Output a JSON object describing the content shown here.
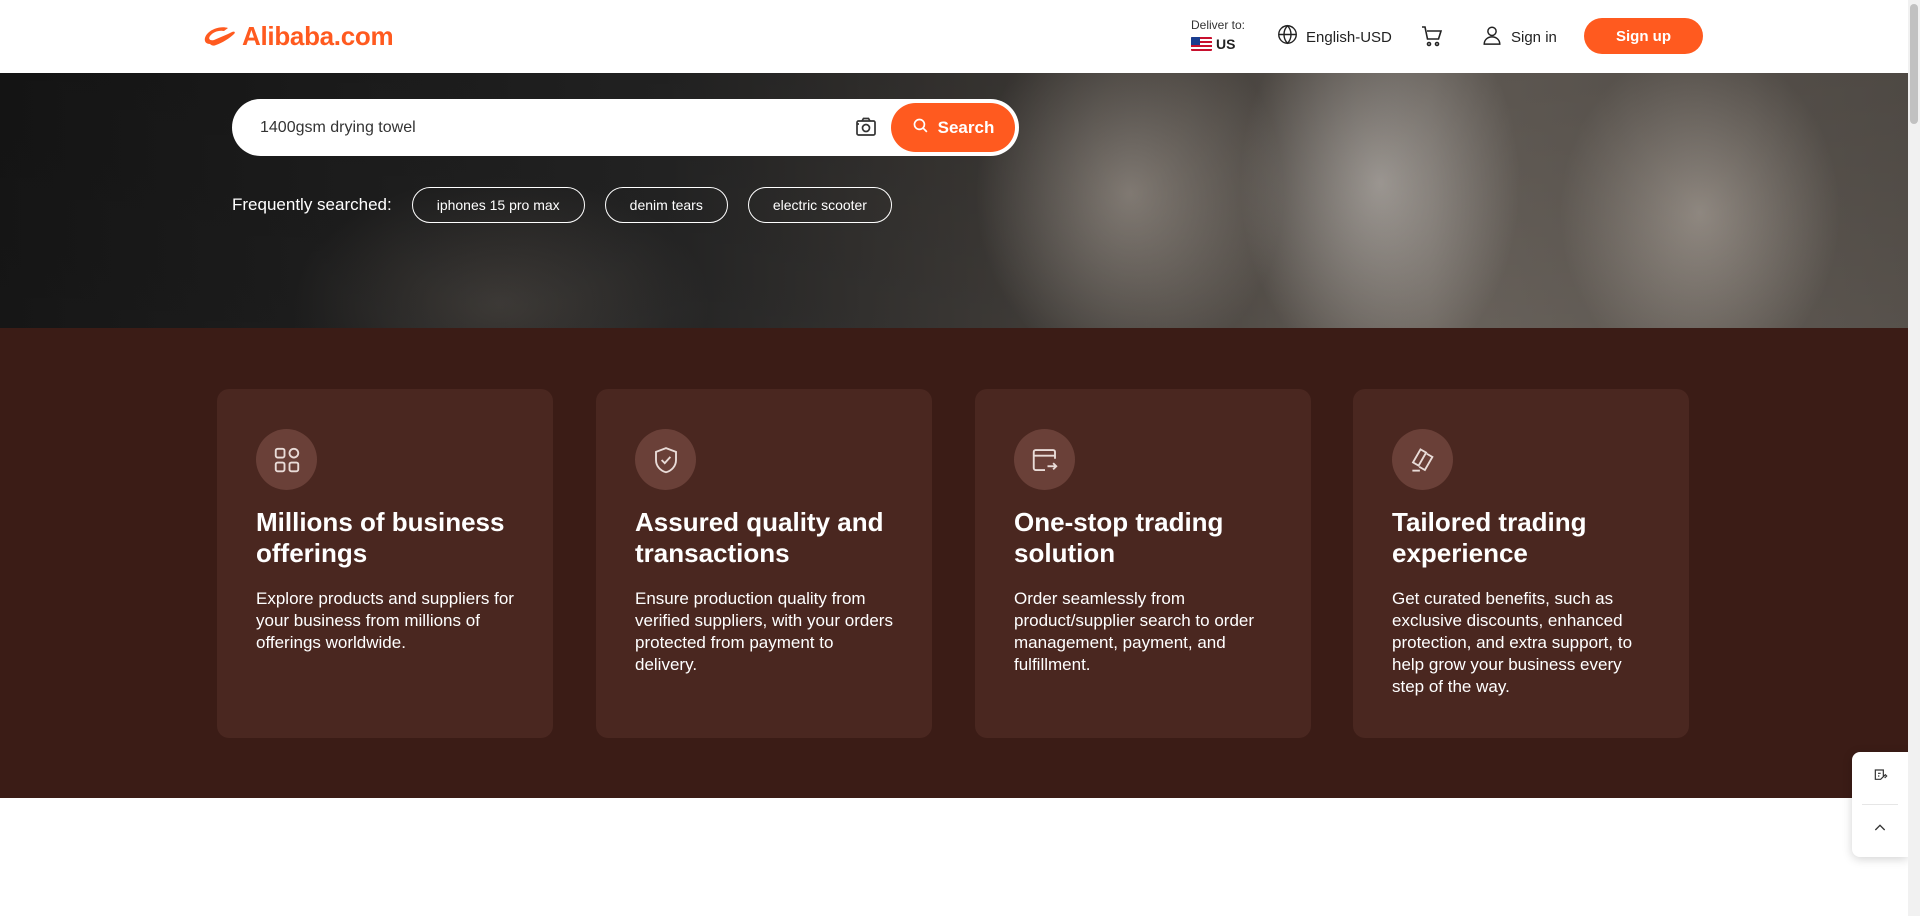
{
  "header": {
    "logo_text": "Alibaba.com",
    "deliver_label": "Deliver to:",
    "deliver_country": "US",
    "language_currency": "English-USD",
    "sign_in": "Sign in",
    "sign_up": "Sign up"
  },
  "search": {
    "value": "1400gsm drying towel",
    "button_label": "Search"
  },
  "frequently_searched": {
    "label": "Frequently searched:",
    "chips": [
      "iphones 15 pro max",
      "denim tears",
      "electric scooter"
    ]
  },
  "features": [
    {
      "icon": "grid-icon",
      "title": "Millions of business offerings",
      "description": "Explore products and suppliers for your business from millions of offerings worldwide."
    },
    {
      "icon": "shield-check-icon",
      "title": "Assured quality and transactions",
      "description": "Ensure production quality from verified suppliers, with your orders protected from payment to delivery."
    },
    {
      "icon": "trade-flow-icon",
      "title": "One-stop trading solution",
      "description": "Order seamlessly from product/supplier search to order management, payment, and fulfillment."
    },
    {
      "icon": "tailored-pages-icon",
      "title": "Tailored trading experience",
      "description": "Get curated benefits, such as exclusive discounts, enhanced protection, and extra support, to help grow your business every step of the way."
    }
  ],
  "colors": {
    "accent": "#ff5a1f",
    "features_bg": "#3b1c16",
    "card_bg": "#4a2720"
  }
}
